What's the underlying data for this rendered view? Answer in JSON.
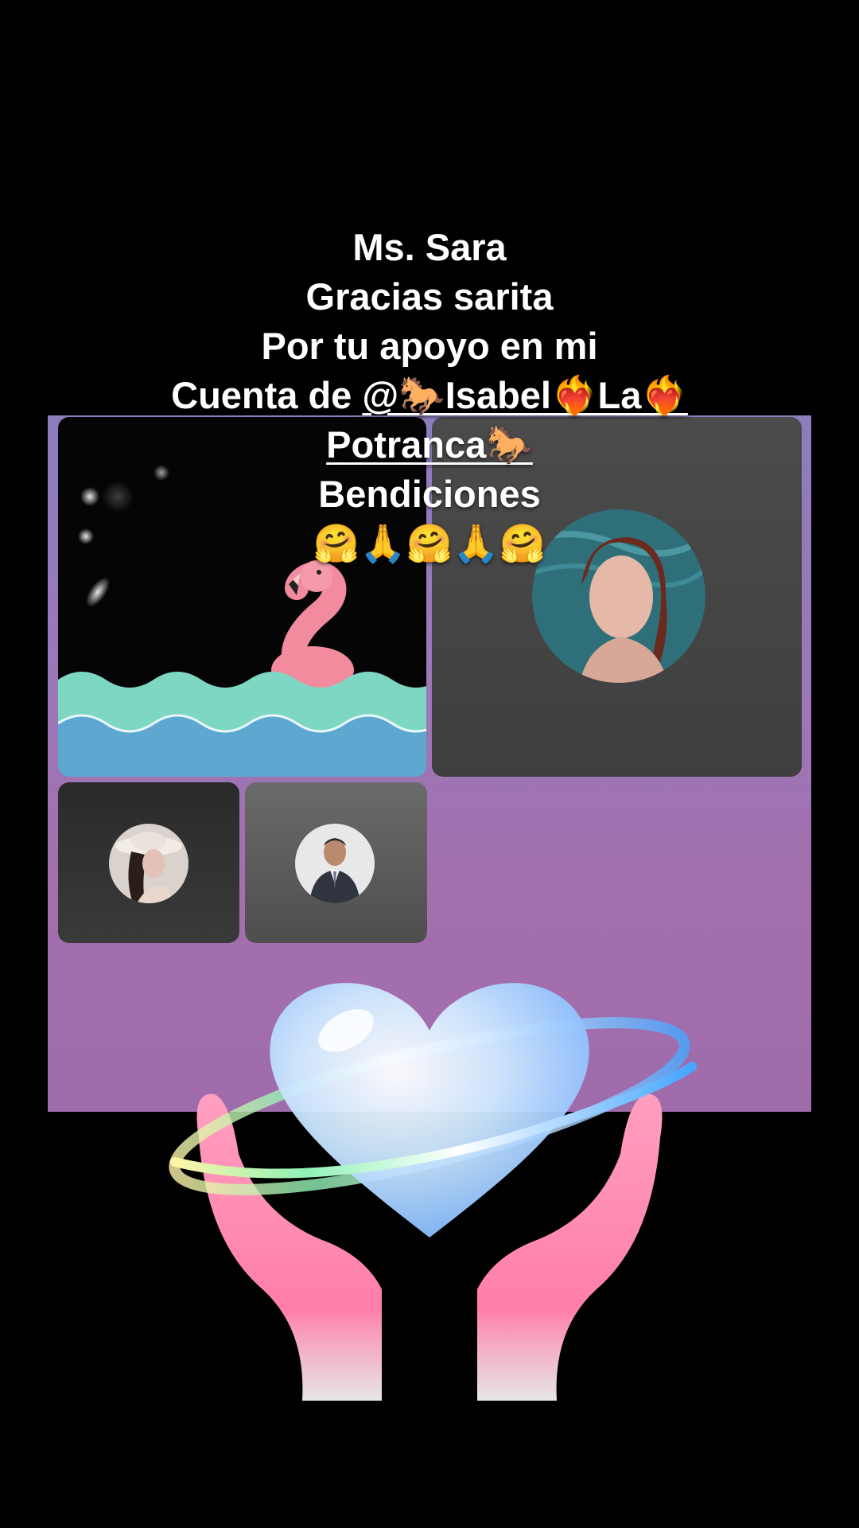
{
  "caption": {
    "line1": "Ms. Sara",
    "line2": "Gracias sarita",
    "line3": "Por tu apoyo en mi",
    "line4_prefix": "Cuenta de ",
    "mention_part1": "@🐎Isabel❤️‍🔥La❤️‍🔥",
    "mention_part2": "Potranca🐎",
    "line6": "Bendiciones",
    "line7": "🤗🙏🤗🙏🤗"
  },
  "tiles": [
    {
      "name": "flamingo-video-tile",
      "icon": "flamingo-icon"
    },
    {
      "name": "woman-avatar-tile",
      "icon": "avatar"
    },
    {
      "name": "hat-woman-avatar-tile",
      "icon": "avatar"
    },
    {
      "name": "man-suit-avatar-tile",
      "icon": "avatar"
    }
  ],
  "colors": {
    "background": "#000000",
    "panel": "#9a78b9",
    "water": "#5fa6cf",
    "wave": "#7fd6c4",
    "flamingo": "#f38ca0"
  }
}
